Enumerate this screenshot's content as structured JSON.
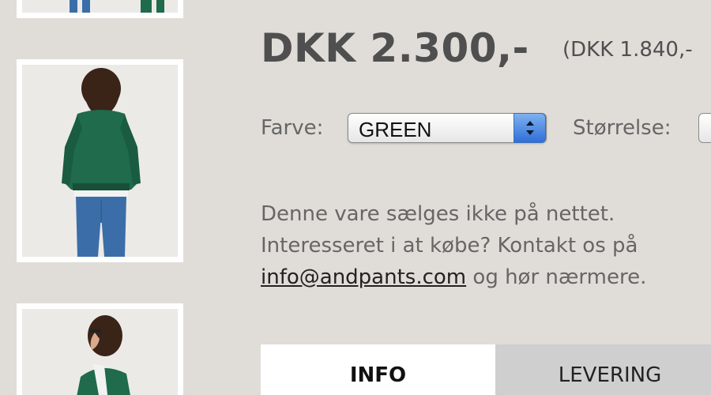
{
  "product": {
    "price": "DKK 2.300,-",
    "price_ex_vat": "(DKK 1.840,-"
  },
  "options": {
    "color_label": "Farve:",
    "color_value": "GREEN",
    "size_label": "Størrelse:"
  },
  "description": {
    "line1": "Denne vare sælges ikke på nettet.",
    "line2": "Interesseret i at købe? Kontakt os på",
    "email": "info@andpants.com",
    "line3_rest": " og hør nærmere."
  },
  "tabs": [
    {
      "label": "INFO",
      "active": true
    },
    {
      "label": "LEVERING",
      "active": false
    }
  ],
  "thumbnails": [
    {
      "icon": "product-thumbnail-front-partial"
    },
    {
      "icon": "product-thumbnail-back"
    },
    {
      "icon": "product-thumbnail-side"
    }
  ],
  "colors": {
    "background": "#e0ddd8",
    "price_text": "#4f4f4f",
    "jacket": "#1f6b4c",
    "select_arrow": "#2f6fd8"
  }
}
